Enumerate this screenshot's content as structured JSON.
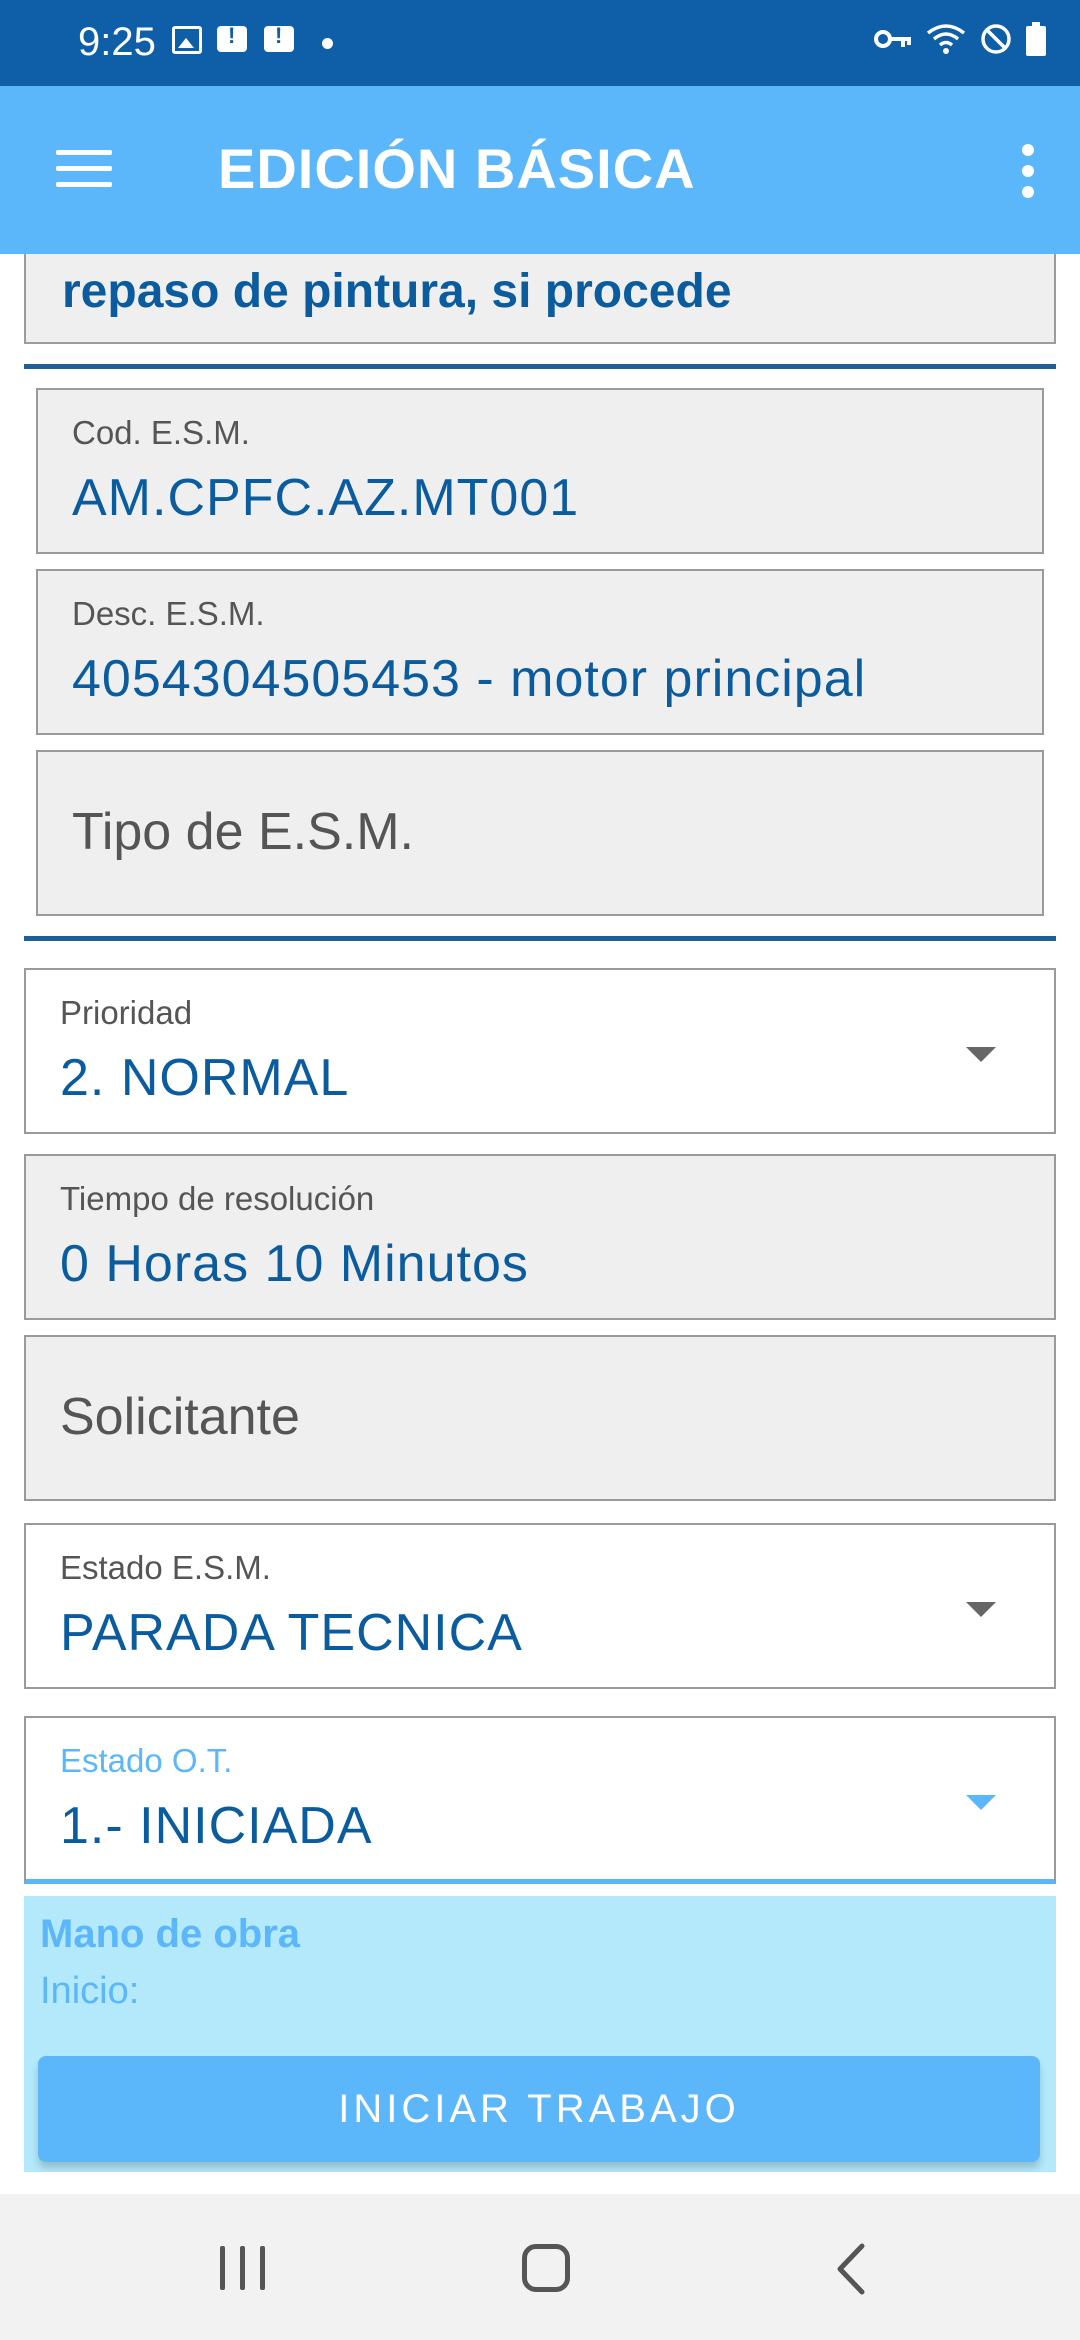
{
  "status_bar": {
    "time": "9:25",
    "icons": [
      "image-icon",
      "message-alert-icon",
      "message-alert-icon",
      "dot-icon",
      "vpn-key-icon",
      "wifi-icon",
      "do-not-disturb-icon",
      "battery-icon"
    ]
  },
  "app_bar": {
    "title": "EDICIÓN BÁSICA",
    "menu_icon": "hamburger-menu-icon",
    "more_icon": "more-vert-icon"
  },
  "form": {
    "description_partial": "repaso de pintura, si procede",
    "cod_esm": {
      "label": "Cod. E.S.M.",
      "value": "AM.CPFC.AZ.MT001"
    },
    "desc_esm": {
      "label": "Desc. E.S.M.",
      "value": "4054304505453 - motor principal"
    },
    "tipo_esm": {
      "placeholder": "Tipo de E.S.M."
    },
    "prioridad": {
      "label": "Prioridad",
      "value": "2. NORMAL"
    },
    "tiempo": {
      "label": "Tiempo de resolución",
      "value": "0 Horas 10 Minutos"
    },
    "solicitante": {
      "placeholder": "Solicitante"
    },
    "estado_esm": {
      "label": "Estado E.S.M.",
      "value": "PARADA TECNICA"
    },
    "estado_ot": {
      "label": "Estado O.T.",
      "value": "1.- INICIADA"
    }
  },
  "labor": {
    "title": "Mano de obra",
    "inicio_label": "Inicio:",
    "start_button": "INICIAR TRABAJO"
  },
  "nav_bar": {
    "icons": [
      "recents-icon",
      "home-icon",
      "back-icon"
    ]
  },
  "colors": {
    "status_bar": "#0e5fa8",
    "app_bar": "#5bb7f9",
    "value_text": "#0b5c9e",
    "labor_bg": "#b3e9fb"
  }
}
